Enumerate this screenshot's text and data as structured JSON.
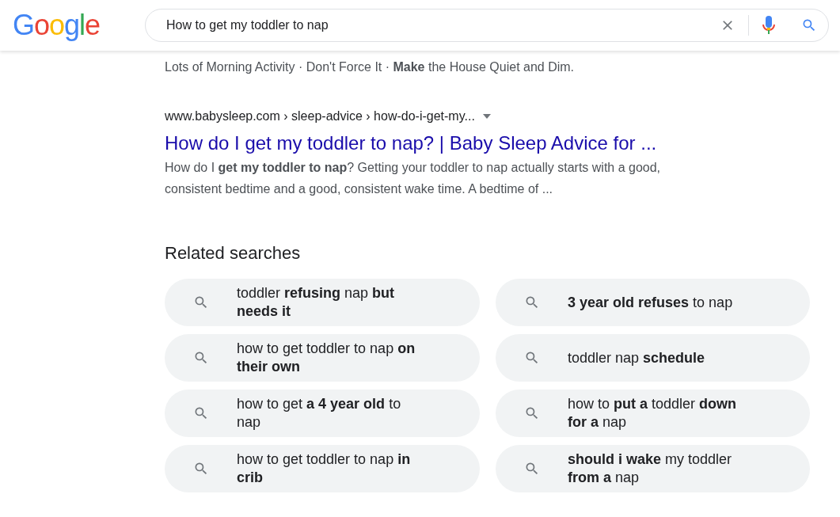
{
  "header": {
    "logo": "Google",
    "search": {
      "value": "How to get my toddler to nap"
    }
  },
  "snippet_fragment": "Lots of Morning Activity · Don't Force It · **Make** the House Quiet and Dim.",
  "result": {
    "breadcrumb": "www.babysleep.com › sleep-advice › how-do-i-get-my...",
    "title": "How do I get my toddler to nap? | Baby Sleep Advice for ...",
    "snippet": "How do I **get my toddler to nap**? Getting your toddler to nap actually starts with a good, consistent bedtime and a good, consistent wake time. A bedtime of ..."
  },
  "related_searches": {
    "heading": "Related searches",
    "items": [
      "toddler **refusing** nap **but needs it**",
      "**3 year old refuses** to nap",
      "how to get toddler to nap **on their own**",
      "toddler nap **schedule**",
      "how to get **a 4 year old** to nap",
      "how to **put a** toddler **down for a** nap",
      "how to get toddler to nap **in crib**",
      "**should i wake** my toddler **from a** nap"
    ]
  }
}
